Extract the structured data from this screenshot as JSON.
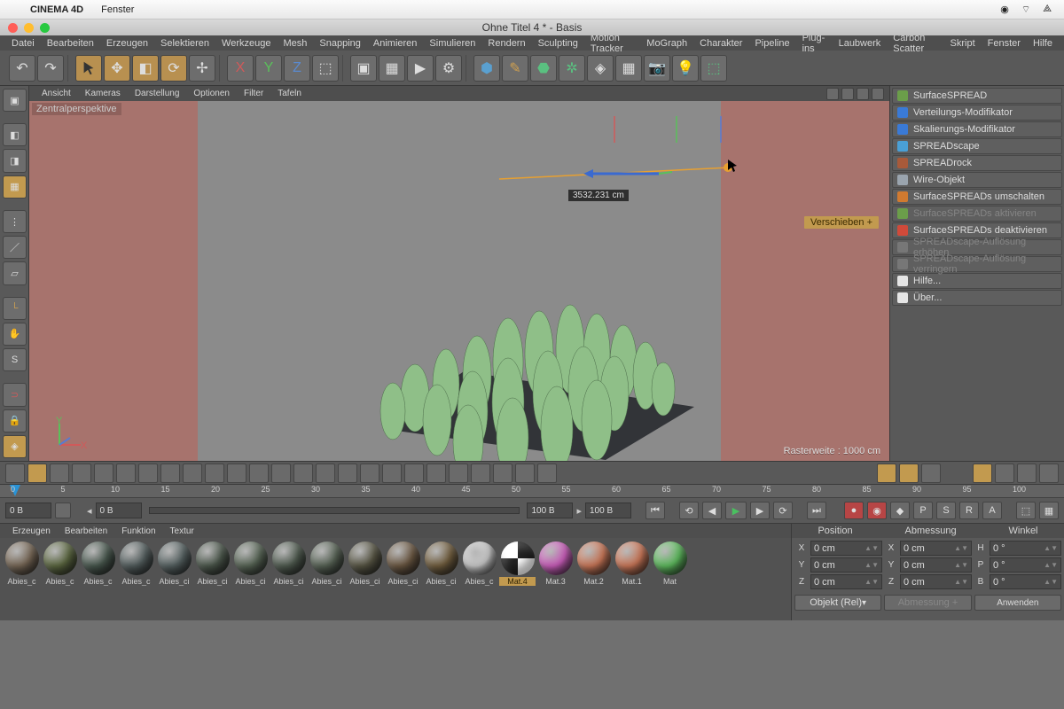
{
  "mac": {
    "app": "CINEMA 4D",
    "menu": "Fenster"
  },
  "doc_title": "Ohne Titel 4 * - Basis",
  "menu": [
    "Datei",
    "Bearbeiten",
    "Erzeugen",
    "Selektieren",
    "Werkzeuge",
    "Mesh",
    "Snapping",
    "Animieren",
    "Simulieren",
    "Rendern",
    "Sculpting",
    "Motion Tracker",
    "MoGraph",
    "Charakter",
    "Pipeline",
    "Plug-ins",
    "Laubwerk",
    "Carbon Scatter",
    "Skript",
    "Fenster",
    "Hilfe"
  ],
  "viewport_menu": [
    "Ansicht",
    "Kameras",
    "Darstellung",
    "Optionen",
    "Filter",
    "Tafeln"
  ],
  "perspective": "Zentralperspektive",
  "grid_info": "Rasterweite : 1000 cm",
  "tool_hint": "Verschieben",
  "readout": "3532.231 cm",
  "right_panel": [
    {
      "label": "SurfaceSPREAD",
      "color": "#6b9e4a"
    },
    {
      "label": "Verteilungs-Modifikator",
      "color": "#3a7ad6"
    },
    {
      "label": "Skalierungs-Modifikator",
      "color": "#3a7ad6"
    },
    {
      "label": "SPREADscape",
      "color": "#4aa0d6"
    },
    {
      "label": "SPREADrock",
      "color": "#a85a3a"
    },
    {
      "label": "Wire-Objekt",
      "color": "#9aa4ae"
    },
    {
      "label": "SurfaceSPREADs umschalten",
      "color": "#d07a30"
    },
    {
      "label": "SurfaceSPREADs aktivieren",
      "color": "#6b9e4a",
      "dim": true
    },
    {
      "label": "SurfaceSPREADs deaktivieren",
      "color": "#d04a3a"
    },
    {
      "label": "SPREADscape-Auflösung erhöhen",
      "color": "#777",
      "dim": true
    },
    {
      "label": "SPREADscape-Auflösung verringern",
      "color": "#777",
      "dim": true
    },
    {
      "label": "Hilfe...",
      "color": "#e5e5e5"
    },
    {
      "label": "Über...",
      "color": "#e5e5e5"
    }
  ],
  "timeline": {
    "frames": [
      0,
      5,
      10,
      15,
      20,
      25,
      30,
      35,
      40,
      45,
      50,
      55,
      60,
      65,
      70,
      75,
      80,
      85,
      90,
      95,
      100
    ],
    "start": "0 B",
    "end": "100 B",
    "t1": "0 B",
    "t2": "100 B",
    "r": "0 B"
  },
  "materials_menu": [
    "Erzeugen",
    "Bearbeiten",
    "Funktion",
    "Textur"
  ],
  "materials": [
    {
      "name": "Abies_c",
      "bg": "#7a6a58"
    },
    {
      "name": "Abies_c",
      "bg": "#5e6a42"
    },
    {
      "name": "Abies_c",
      "bg": "#4a5a50"
    },
    {
      "name": "Abies_c",
      "bg": "#556060"
    },
    {
      "name": "Abies_ci",
      "bg": "#586464"
    },
    {
      "name": "Abies_ci",
      "bg": "#4e5a4e"
    },
    {
      "name": "Abies_ci",
      "bg": "#5a6858"
    },
    {
      "name": "Abies_ci",
      "bg": "#525e52"
    },
    {
      "name": "Abies_ci",
      "bg": "#5a6658"
    },
    {
      "name": "Abies_ci",
      "bg": "#5a5846"
    },
    {
      "name": "Abies_ci",
      "bg": "#6e5a44"
    },
    {
      "name": "Abies_ci",
      "bg": "#746040"
    },
    {
      "name": "Abies_c",
      "bg": "#d0d0d0"
    },
    {
      "name": "Mat.4",
      "bg": "#f0f0f0",
      "sel": true,
      "checker": true
    },
    {
      "name": "Mat.3",
      "bg": "#d060c0"
    },
    {
      "name": "Mat.2",
      "bg": "#d07a5a"
    },
    {
      "name": "Mat.1",
      "bg": "#d07a5a"
    },
    {
      "name": "Mat",
      "bg": "#60c060"
    }
  ],
  "coords": {
    "head": [
      "Position",
      "Abmessung",
      "Winkel"
    ],
    "rows": [
      {
        "a": "X",
        "av": "0 cm",
        "b": "X",
        "bv": "0 cm",
        "c": "H",
        "cv": "0 °"
      },
      {
        "a": "Y",
        "av": "0 cm",
        "b": "Y",
        "bv": "0 cm",
        "c": "P",
        "cv": "0 °"
      },
      {
        "a": "Z",
        "av": "0 cm",
        "b": "Z",
        "bv": "0 cm",
        "c": "B",
        "cv": "0 °"
      }
    ],
    "ref": "Objekt (Rel)",
    "dim": "Abmessung +",
    "apply": "Anwenden"
  }
}
